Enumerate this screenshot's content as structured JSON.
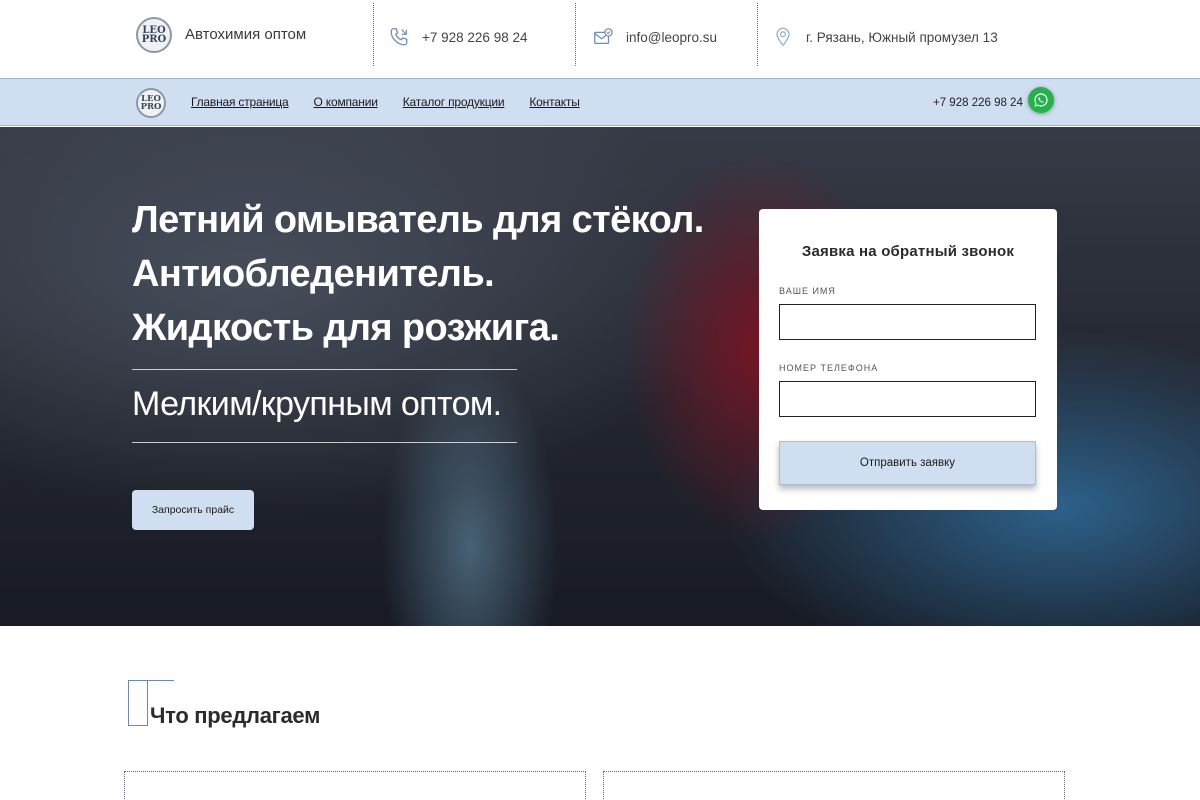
{
  "brand": {
    "logo_top": "LEO",
    "logo_bottom": "PRO",
    "tagline": "Автохимия оптом"
  },
  "contacts": {
    "phone": "+7 928 226 98 24",
    "email": "info@leopro.su",
    "address": "г. Рязань, Южный промузел 13"
  },
  "nav": {
    "items": [
      "Главная страница",
      "О компании",
      "Каталог продукции",
      "Контакты"
    ],
    "phone": "+7 928 226 98 24"
  },
  "hero": {
    "title_lines": [
      "Летний омыватель для стёкол.",
      "Антиобледенитель.",
      "Жидкость для розжига."
    ],
    "subtitle": "Мелким/крупным оптом.",
    "price_button": "Запросить прайс"
  },
  "callback_form": {
    "title": "Заявка на обратный звонок",
    "name_label": "Ваше имя",
    "name_value": "",
    "phone_label": "Номер телефона",
    "phone_value": "",
    "submit_label": "Отправить заявку"
  },
  "offer": {
    "title": "Что предлагаем"
  },
  "colors": {
    "accent": "#cfdff1",
    "whatsapp": "#25b14b",
    "text": "#2b2b2b"
  }
}
